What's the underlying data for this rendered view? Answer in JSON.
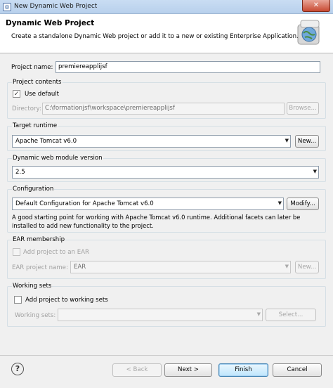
{
  "window": {
    "title": "New Dynamic Web Project",
    "close_label": "✕"
  },
  "header": {
    "title": "Dynamic Web Project",
    "description": "Create a standalone Dynamic Web project or add it to a new or existing Enterprise Application."
  },
  "project_name": {
    "label": "Project name:",
    "value": "premiereapplijsf"
  },
  "project_contents": {
    "title": "Project contents",
    "use_default_label": "Use default",
    "use_default_checked": true,
    "directory_label": "Directory:",
    "directory_value": "C:\\formationjsf\\workspace\\premiereapplijsf",
    "browse_label": "Browse..."
  },
  "target_runtime": {
    "title": "Target runtime",
    "value": "Apache Tomcat v6.0",
    "new_label": "New..."
  },
  "module_version": {
    "title": "Dynamic web module version",
    "value": "2.5"
  },
  "configuration": {
    "title": "Configuration",
    "value": "Default Configuration for Apache Tomcat v6.0",
    "modify_label": "Modify...",
    "description_line1": "A good starting point for working with Apache Tomcat v6.0 runtime. Additional facets can later be",
    "description_line2": "installed to add new functionality to the project."
  },
  "ear": {
    "title": "EAR membership",
    "add_label": "Add project to an EAR",
    "add_checked": false,
    "name_label": "EAR project name:",
    "name_value": "EAR",
    "new_label": "New..."
  },
  "working_sets": {
    "title": "Working sets",
    "add_label": "Add project to working sets",
    "add_checked": false,
    "sets_label": "Working sets:",
    "sets_value": "",
    "select_label": "Select..."
  },
  "footer": {
    "help_label": "?",
    "back_label": "< Back",
    "next_label": "Next >",
    "finish_label": "Finish",
    "cancel_label": "Cancel"
  }
}
